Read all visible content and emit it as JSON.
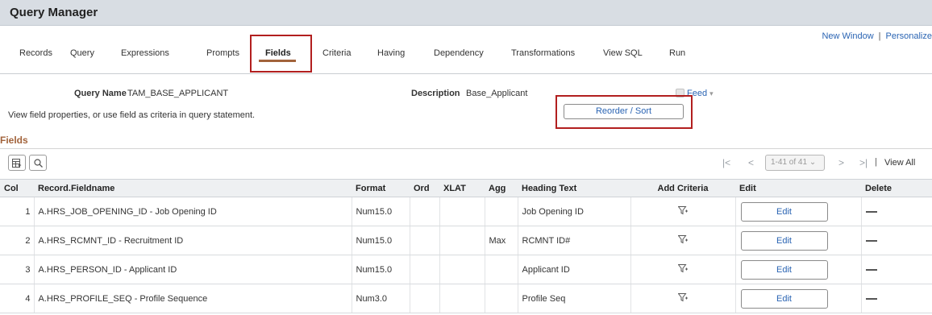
{
  "app": {
    "title": "Query Manager"
  },
  "toplinks": {
    "new_window": "New Window",
    "personalize": "Personalize"
  },
  "tabs": [
    {
      "label": "Records"
    },
    {
      "label": "Query"
    },
    {
      "label": "Expressions"
    },
    {
      "label": "Prompts"
    },
    {
      "label": "Fields",
      "active": true
    },
    {
      "label": "Criteria"
    },
    {
      "label": "Having"
    },
    {
      "label": "Dependency"
    },
    {
      "label": "Transformations"
    },
    {
      "label": "View SQL"
    },
    {
      "label": "Run"
    }
  ],
  "query": {
    "name_label": "Query Name",
    "name_value": "TAM_BASE_APPLICANT",
    "description_label": "Description",
    "description_value": "Base_Applicant",
    "feed_label": "Feed",
    "hint": "View field properties, or use field as criteria in query statement.",
    "reorder_label": "Reorder / Sort"
  },
  "fields_section": {
    "title": "Fields",
    "pager_text": "1-41 of 41",
    "view_all": "View All",
    "columns": {
      "col": "Col",
      "record_fieldname": "Record.Fieldname",
      "format": "Format",
      "ord": "Ord",
      "xlat": "XLAT",
      "agg": "Agg",
      "heading_text": "Heading Text",
      "add_criteria": "Add Criteria",
      "edit": "Edit",
      "delete": "Delete"
    },
    "rows": [
      {
        "col": "1",
        "fieldname": "A.HRS_JOB_OPENING_ID - Job Opening ID",
        "format": "Num15.0",
        "ord": "",
        "xlat": "",
        "agg": "",
        "heading": "Job Opening ID",
        "edit_label": "Edit"
      },
      {
        "col": "2",
        "fieldname": "A.HRS_RCMNT_ID - Recruitment ID",
        "format": "Num15.0",
        "ord": "",
        "xlat": "",
        "agg": "Max",
        "heading": "RCMNT ID#",
        "edit_label": "Edit"
      },
      {
        "col": "3",
        "fieldname": "A.HRS_PERSON_ID - Applicant ID",
        "format": "Num15.0",
        "ord": "",
        "xlat": "",
        "agg": "",
        "heading": "Applicant ID",
        "edit_label": "Edit"
      },
      {
        "col": "4",
        "fieldname": "A.HRS_PROFILE_SEQ - Profile Sequence",
        "format": "Num3.0",
        "ord": "",
        "xlat": "",
        "agg": "",
        "heading": "Profile Seq",
        "edit_label": "Edit"
      }
    ]
  },
  "colors": {
    "accent_brown": "#a2633b",
    "highlight_red": "#b21f1f",
    "link_blue": "#2a64b3",
    "title_bar": "#d8dde3"
  },
  "icons": {
    "grid_toolbar": "personalize-grid-icon",
    "search": "search-icon",
    "add_criteria": "funnel-criteria-icon",
    "delete": "minus-icon"
  }
}
